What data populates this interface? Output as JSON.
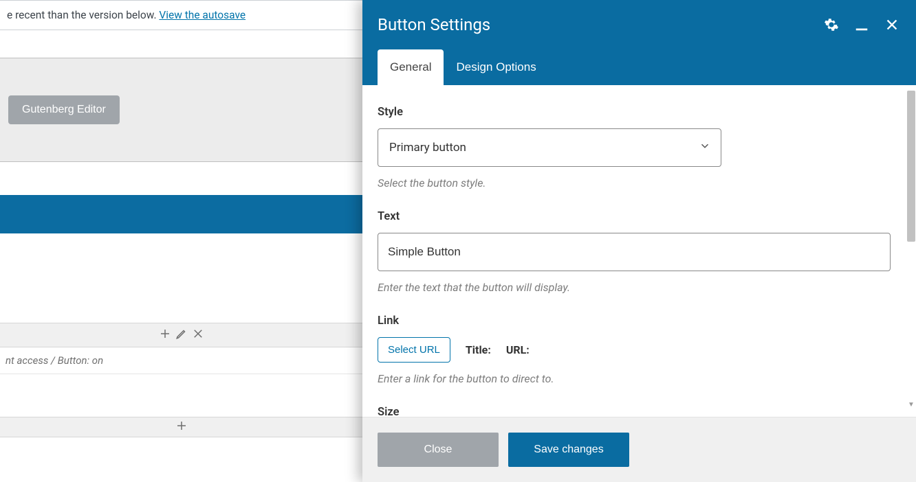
{
  "editor": {
    "notice_fragment": "e recent than the version below. ",
    "notice_link": "View the autosave",
    "gutenberg_button": "Gutenberg Editor",
    "breadcrumb_fragment": "nt access  /  Button: on"
  },
  "panel": {
    "title": "Button Settings",
    "tabs": {
      "general": "General",
      "design": "Design Options"
    },
    "fields": {
      "style": {
        "label": "Style",
        "value": "Primary button",
        "hint": "Select the button style."
      },
      "text": {
        "label": "Text",
        "value": "Simple Button",
        "hint": "Enter the text that the button will display."
      },
      "link": {
        "label": "Link",
        "select_url": "Select URL",
        "title_label": "Title:",
        "url_label": "URL:",
        "hint": "Enter a link for the button to direct to."
      },
      "size": {
        "label": "Size"
      }
    },
    "footer": {
      "close": "Close",
      "save": "Save changes"
    }
  }
}
